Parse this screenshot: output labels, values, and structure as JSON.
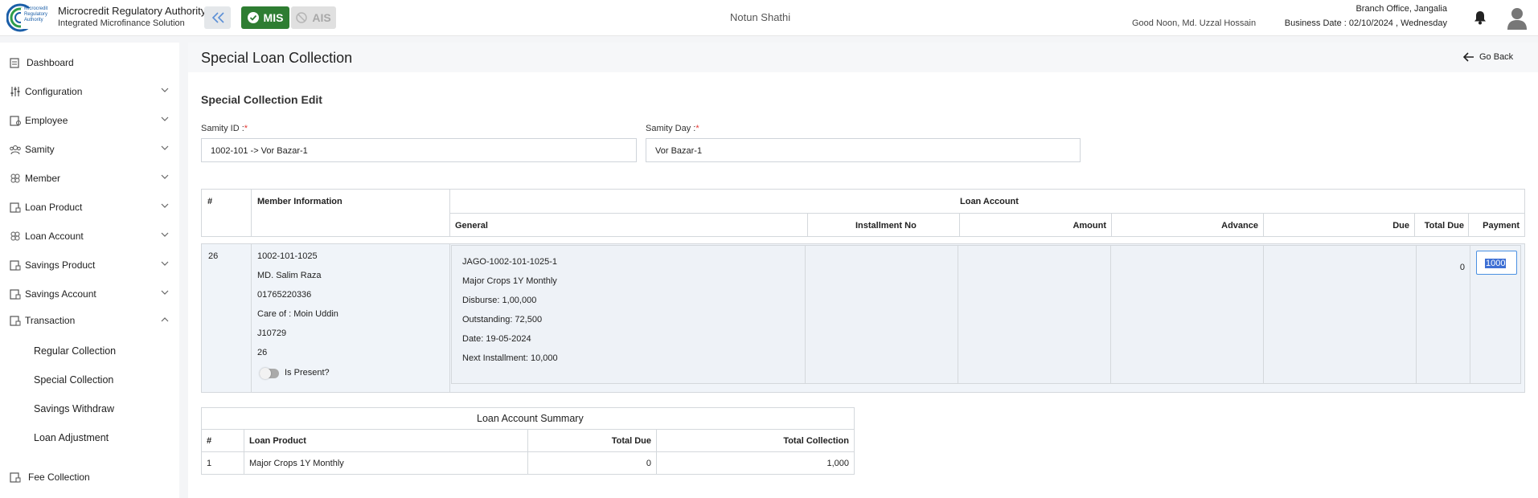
{
  "header": {
    "org_name": "Microcredit Regulatory Authority",
    "org_sub": "Integrated Microfinance Solution",
    "logo_text": [
      "Microcredit",
      "Regulatory",
      "Authority"
    ],
    "mis_label": "MIS",
    "ais_label": "AIS",
    "app_title": "Notun Shathi",
    "greeting": "Good Noon, Md. Uzzal Hossain",
    "branch": "Branch Office, Jangalia",
    "business_date": "Business Date : 02/10/2024 , Wednesday"
  },
  "sidebar": {
    "items": [
      {
        "label": "Dashboard",
        "icon": "dashboard-icon"
      },
      {
        "label": "Configuration",
        "icon": "sliders-icon"
      },
      {
        "label": "Employee",
        "icon": "employee-icon"
      },
      {
        "label": "Samity",
        "icon": "group-icon"
      },
      {
        "label": "Member",
        "icon": "member-icon"
      },
      {
        "label": "Loan Product",
        "icon": "loan-product-icon"
      },
      {
        "label": "Loan Account",
        "icon": "loan-account-icon"
      },
      {
        "label": "Savings Product",
        "icon": "savings-product-icon"
      },
      {
        "label": "Savings Account",
        "icon": "savings-account-icon"
      },
      {
        "label": "Transaction",
        "icon": "transaction-icon"
      },
      {
        "label": "Fee Collection",
        "icon": "fee-icon"
      }
    ],
    "transaction_sub": [
      "Regular Collection",
      "Special Collection",
      "Savings Withdraw",
      "Loan Adjustment"
    ]
  },
  "page": {
    "title": "Special Loan Collection",
    "go_back": "Go Back",
    "section_title": "Special Collection Edit",
    "samity_id_label": "Samity ID :",
    "samity_id_value": "1002-101 -> Vor Bazar-1",
    "samity_day_label": "Samity Day :",
    "samity_day_value": "Vor Bazar-1",
    "required_mark": "*"
  },
  "grid": {
    "headers": {
      "hash": "#",
      "member_info": "Member Information",
      "loan_account": "Loan Account",
      "general": "General",
      "installment_no": "Installment No",
      "amount": "Amount",
      "advance": "Advance",
      "due": "Due",
      "total_due": "Total Due",
      "payment": "Payment"
    },
    "row": {
      "index": "26",
      "member": [
        "1002-101-1025",
        "MD. Salim Raza",
        "01765220336",
        "Care of : Moin Uddin",
        "J10729",
        "26"
      ],
      "is_present_label": "Is Present?",
      "loan_general": [
        "JAGO-1002-101-1025-1",
        "Major Crops 1Y Monthly",
        "Disburse: 1,00,000",
        "Outstanding: 72,500",
        "Date: 19-05-2024",
        "Next Installment: 10,000"
      ],
      "total_due": "0",
      "payment": "1000"
    }
  },
  "summary": {
    "title": "Loan Account Summary",
    "headers": [
      "#",
      "Loan Product",
      "Total Due",
      "Total Collection"
    ],
    "rows": [
      [
        "1",
        "Major Crops 1Y Monthly",
        "0",
        "1,000"
      ]
    ]
  }
}
